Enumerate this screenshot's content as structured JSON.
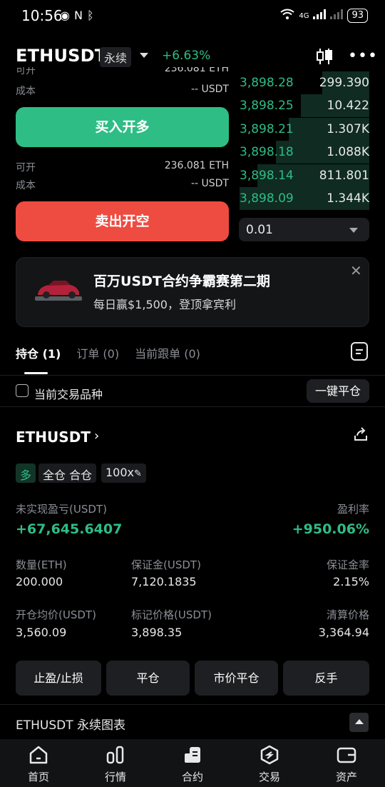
{
  "status": {
    "time": "10:56",
    "net": "4G",
    "battery": "93"
  },
  "header": {
    "symbol": "ETHUSDT",
    "type": "永续",
    "change": "+6.63%"
  },
  "buy_form": {
    "avail_label_partial": "可开",
    "avail_partial": "236.081 ETH",
    "cost_label": "成本",
    "cost_value": "-- USDT",
    "buy_button": "买入开多",
    "avail_label": "可开",
    "avail_value": "236.081 ETH",
    "cost_label2": "成本",
    "cost_value2": "-- USDT",
    "sell_button": "卖出开空"
  },
  "orderbook": {
    "rows": [
      {
        "price": "3,898.28",
        "qty": "299.390",
        "depth": 0.36
      },
      {
        "price": "3,898.25",
        "qty": "10.422",
        "depth": 0.53
      },
      {
        "price": "3,898.21",
        "qty": "1.307K",
        "depth": 0.62
      },
      {
        "price": "3,898.18",
        "qty": "1.088K",
        "depth": 0.72
      },
      {
        "price": "3,898.14",
        "qty": "811.801",
        "depth": 0.86
      },
      {
        "price": "3,898.09",
        "qty": "1.344K",
        "depth": 1.0
      }
    ],
    "precision": "0.01"
  },
  "banner": {
    "title": "百万USDT合约争霸赛第二期",
    "subtitle": "每日赢$1,500，登顶拿宾利"
  },
  "tabs": {
    "positions": "持仓 (1)",
    "orders": "订单 (0)",
    "copy": "当前跟单 (0)"
  },
  "filter": {
    "current_only": "当前交易品种",
    "close_all": "一键平仓"
  },
  "position": {
    "symbol": "ETHUSDT",
    "side": "多",
    "mode": "全仓 合仓",
    "leverage": "100x",
    "upnl_label": "未实现盈亏(USDT)",
    "upnl": "+67,645.6407",
    "roe_label": "盈利率",
    "roe": "+950.06%",
    "qty_label": "数量(ETH)",
    "qty": "200.000",
    "margin_label": "保证金(USDT)",
    "margin": "7,120.1835",
    "margin_rate_label": "保证金率",
    "margin_rate": "2.15%",
    "entry_label": "开仓均价(USDT)",
    "entry": "3,560.09",
    "mark_label": "标记价格(USDT)",
    "mark": "3,898.35",
    "liq_label": "清算价格",
    "liq": "3,364.94",
    "actions": [
      "止盈/止损",
      "平仓",
      "市价平仓",
      "反手"
    ]
  },
  "chart_section": {
    "title": "ETHUSDT 永续图表"
  },
  "nav": [
    "首页",
    "行情",
    "合约",
    "交易",
    "资产"
  ]
}
